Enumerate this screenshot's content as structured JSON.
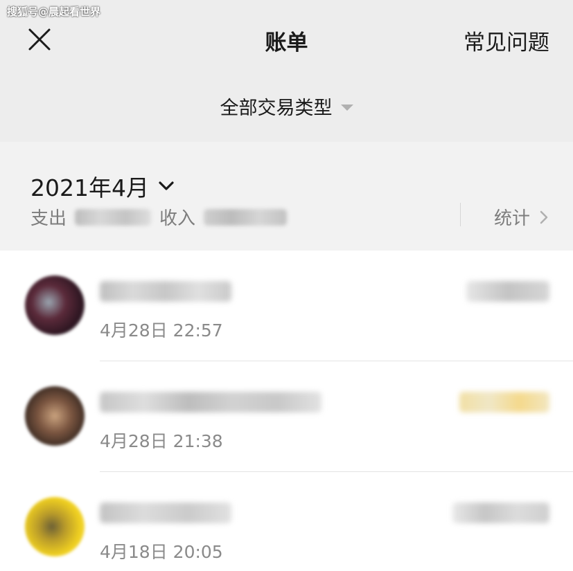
{
  "watermark": "搜狐号@晨起看世界",
  "header": {
    "title": "账单",
    "faq_label": "常见问题",
    "filter_label": "全部交易类型"
  },
  "summary": {
    "month": "2021年4月",
    "expense_label": "支出",
    "income_label": "收入",
    "stats_label": "统计"
  },
  "transactions": [
    {
      "time": "4月28日 22:57"
    },
    {
      "time": "4月28日 21:38"
    },
    {
      "time": "4月18日 20:05"
    }
  ],
  "icons": [
    "close-icon",
    "chevron-down-icon",
    "chevron-right-icon",
    "caret-down-icon"
  ]
}
